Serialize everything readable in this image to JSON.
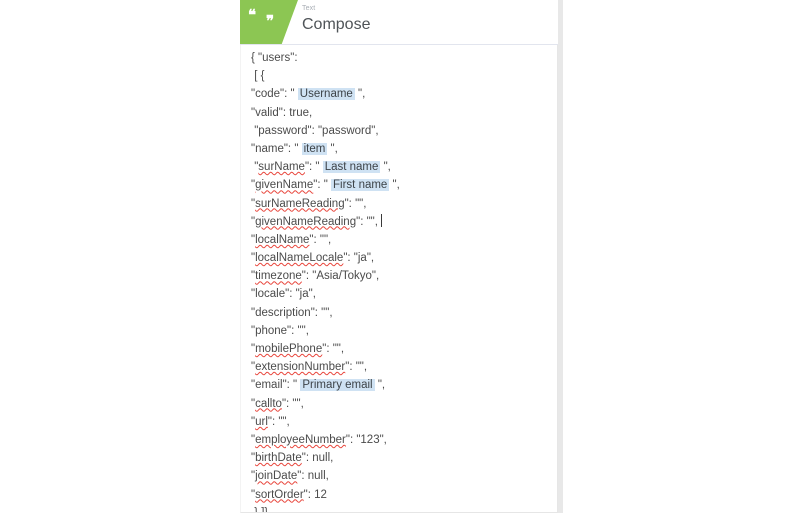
{
  "card": {
    "header": {
      "kicker": "Text",
      "title": "Compose",
      "icon": "quote-icon",
      "quote_open": "❝",
      "quote_close": "❞",
      "accent_color": "#8cc653"
    },
    "editor": {
      "chip_color": "#cfe2f3",
      "spellcheck_underline_color": "#e8443a",
      "text_color": "#4b4b4b",
      "caret_line_index": 10,
      "lines": [
        {
          "indent": 0,
          "parts": [
            {
              "t": "{ \"users\":",
              "k": "plain"
            }
          ]
        },
        {
          "indent": 1,
          "parts": [
            {
              "t": "[ {",
              "k": "plain"
            }
          ]
        },
        {
          "indent": 0,
          "parts": [
            {
              "t": "\"code\": \" ",
              "k": "plain"
            },
            {
              "t": "Username",
              "k": "chip"
            },
            {
              "t": " \",",
              "k": "plain"
            }
          ]
        },
        {
          "indent": 0,
          "parts": [
            {
              "t": "\"valid\": true,",
              "k": "plain"
            }
          ]
        },
        {
          "indent": 1,
          "parts": [
            {
              "t": "\"password\": \"password\",",
              "k": "plain"
            }
          ]
        },
        {
          "indent": 0,
          "parts": [
            {
              "t": "\"name\": \" ",
              "k": "plain"
            },
            {
              "t": "item",
              "k": "chip"
            },
            {
              "t": " \",",
              "k": "plain"
            }
          ]
        },
        {
          "indent": 1,
          "parts": [
            {
              "t": "\"",
              "k": "plain"
            },
            {
              "t": "surName",
              "k": "sp"
            },
            {
              "t": "\": \" ",
              "k": "plain"
            },
            {
              "t": "Last name",
              "k": "chip"
            },
            {
              "t": " \",",
              "k": "plain"
            }
          ]
        },
        {
          "indent": 0,
          "parts": [
            {
              "t": "\"",
              "k": "plain"
            },
            {
              "t": "givenName",
              "k": "sp"
            },
            {
              "t": "\": \" ",
              "k": "plain"
            },
            {
              "t": "First name",
              "k": "chip"
            },
            {
              "t": " \",",
              "k": "plain"
            }
          ]
        },
        {
          "indent": 0,
          "parts": [
            {
              "t": "\"",
              "k": "plain"
            },
            {
              "t": "surNameReading",
              "k": "sp"
            },
            {
              "t": "\": \"\",",
              "k": "plain"
            }
          ]
        },
        {
          "indent": 0,
          "parts": [
            {
              "t": "\"",
              "k": "plain"
            },
            {
              "t": "givenNameReading",
              "k": "sp"
            },
            {
              "t": "\": \"\",",
              "k": "plain"
            }
          ]
        },
        {
          "indent": 0,
          "parts": [
            {
              "t": "\"",
              "k": "plain"
            },
            {
              "t": "localName",
              "k": "sp"
            },
            {
              "t": "\": \"\",",
              "k": "plain"
            }
          ]
        },
        {
          "indent": 0,
          "parts": [
            {
              "t": "\"",
              "k": "plain"
            },
            {
              "t": "localNameLocale",
              "k": "sp"
            },
            {
              "t": "\": \"ja\",",
              "k": "plain"
            }
          ]
        },
        {
          "indent": 0,
          "parts": [
            {
              "t": "\"",
              "k": "plain"
            },
            {
              "t": "timezone",
              "k": "sp"
            },
            {
              "t": "\": \"Asia/Tokyo\",",
              "k": "plain"
            }
          ]
        },
        {
          "indent": 0,
          "parts": [
            {
              "t": "\"locale\": \"ja\",",
              "k": "plain"
            }
          ]
        },
        {
          "indent": 0,
          "parts": [
            {
              "t": "\"description\": \"\",",
              "k": "plain"
            }
          ]
        },
        {
          "indent": 0,
          "parts": [
            {
              "t": "\"phone\": \"\",",
              "k": "plain"
            }
          ]
        },
        {
          "indent": 0,
          "parts": [
            {
              "t": "\"",
              "k": "plain"
            },
            {
              "t": "mobilePhone",
              "k": "sp"
            },
            {
              "t": "\": \"\",",
              "k": "plain"
            }
          ]
        },
        {
          "indent": 0,
          "parts": [
            {
              "t": "\"",
              "k": "plain"
            },
            {
              "t": "extensionNumber",
              "k": "sp"
            },
            {
              "t": "\": \"\",",
              "k": "plain"
            }
          ]
        },
        {
          "indent": 0,
          "parts": [
            {
              "t": "\"email\": \" ",
              "k": "plain"
            },
            {
              "t": "Primary email",
              "k": "chip"
            },
            {
              "t": " \",",
              "k": "plain"
            }
          ]
        },
        {
          "indent": 0,
          "parts": [
            {
              "t": "\"",
              "k": "plain"
            },
            {
              "t": "callto",
              "k": "sp"
            },
            {
              "t": "\": \"\",",
              "k": "plain"
            }
          ]
        },
        {
          "indent": 0,
          "parts": [
            {
              "t": "\"",
              "k": "plain"
            },
            {
              "t": "url",
              "k": "sp"
            },
            {
              "t": "\": \"\",",
              "k": "plain"
            }
          ]
        },
        {
          "indent": 0,
          "parts": [
            {
              "t": "\"",
              "k": "plain"
            },
            {
              "t": "employeeNumber",
              "k": "sp"
            },
            {
              "t": "\": \"123\",",
              "k": "plain"
            }
          ]
        },
        {
          "indent": 0,
          "parts": [
            {
              "t": "\"",
              "k": "plain"
            },
            {
              "t": "birthDate",
              "k": "sp"
            },
            {
              "t": "\": null,",
              "k": "plain"
            }
          ]
        },
        {
          "indent": 0,
          "parts": [
            {
              "t": "\"",
              "k": "plain"
            },
            {
              "t": "joinDate",
              "k": "sp"
            },
            {
              "t": "\": null,",
              "k": "plain"
            }
          ]
        },
        {
          "indent": 0,
          "parts": [
            {
              "t": "\"",
              "k": "plain"
            },
            {
              "t": "sortOrder",
              "k": "sp"
            },
            {
              "t": "\": 12",
              "k": "plain"
            }
          ]
        },
        {
          "indent": 1,
          "parts": [
            {
              "t": "} ]}",
              "k": "plain"
            }
          ]
        }
      ]
    }
  }
}
